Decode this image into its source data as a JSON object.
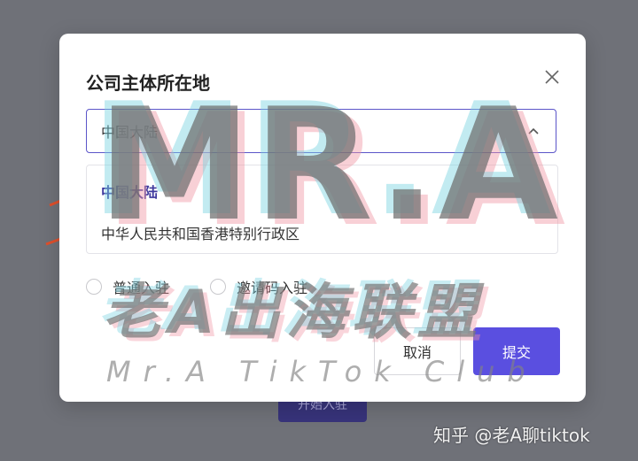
{
  "background": {
    "button_label": "开始入驻"
  },
  "modal": {
    "title": "公司主体所在地",
    "close_icon": "close-icon",
    "select": {
      "value": "中国大陆",
      "icon": "chevron-up-icon",
      "options": [
        "中国大陆",
        "中华人民共和国香港特别行政区"
      ]
    },
    "radios": [
      "普通入驻",
      "邀请码入驻"
    ],
    "cancel_label": "取消",
    "submit_label": "提交"
  },
  "watermark": {
    "big": "MR.A",
    "cn": "老A出海联盟",
    "en": "Mr.A TikTok Club",
    "zhihu": "知乎 @老A聊tiktok"
  },
  "colors": {
    "accent": "#5a4fe0",
    "select_border": "#5b55c9",
    "selected_option": "#3f3a9e",
    "annotation_arrow": "#e0502c",
    "overlay": "#6f7178"
  }
}
